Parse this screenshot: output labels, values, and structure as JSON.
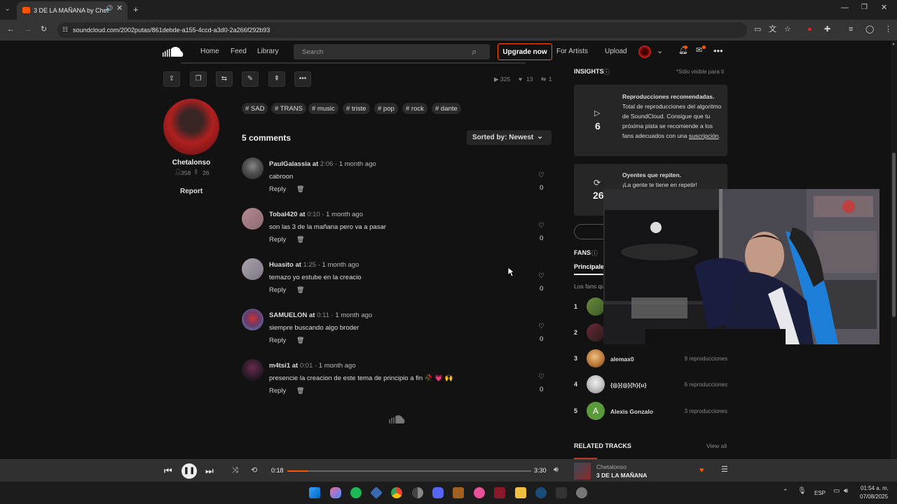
{
  "browser": {
    "tab_title": "3 DE LA MAÑANA by Chet",
    "url": "soundcloud.com/2002putas/861debde-a155-4ccd-a3d0-2a266f292b93"
  },
  "nav": {
    "home": "Home",
    "feed": "Feed",
    "library": "Library",
    "search_placeholder": "Search",
    "upgrade": "Upgrade now",
    "for_artists": "For Artists",
    "upload": "Upload"
  },
  "track_stats": {
    "plays": "325",
    "likes": "13",
    "reposts": "1"
  },
  "tags": [
    "# SAD",
    "# TRANS",
    "# music",
    "# triste",
    "# pop",
    "# rock",
    "# dante"
  ],
  "artist": {
    "name": "Chetalonso",
    "followers": "358",
    "tracks": "26",
    "report": "Report"
  },
  "comments_header": {
    "count": "5 comments",
    "sort": "Sorted by: Newest"
  },
  "comments": [
    {
      "user": "PaulGalassia",
      "at": "at",
      "time": "2:06",
      "ago": "· 1 month ago",
      "text": "cabroon",
      "reply": "Reply",
      "likes": "0"
    },
    {
      "user": "Tobal420",
      "at": "at",
      "time": "0:10",
      "ago": "· 1 month ago",
      "text": "son las 3 de la mañana pero va a pasar",
      "reply": "Reply",
      "likes": "0"
    },
    {
      "user": "Huasito",
      "at": "at",
      "time": "1:25",
      "ago": "· 1 month ago",
      "text": "temazo yo estube en la creacio",
      "reply": "Reply",
      "likes": "0"
    },
    {
      "user": "SAMUELON",
      "at": "at",
      "time": "0:11",
      "ago": "· 1 month ago",
      "text": "siempre buscando algo broder",
      "reply": "Reply",
      "likes": "0"
    },
    {
      "user": "m4tsi1",
      "at": "at",
      "time": "0:01",
      "ago": "· 1 month ago",
      "text": "presencie la creacion de este tema de principio a fin 🥀 💗 🙌",
      "reply": "Reply",
      "likes": "0"
    }
  ],
  "insights": {
    "title": "INSIGHTS",
    "note": "*Sólo visible para ti",
    "card1": {
      "value": "6",
      "title": "Reproducciones recomendadas.",
      "body": "Total de reproducciones del algoritmo de SoundCloud. Consigue que tu próxima pista se recomiende a los fans adecuados con una",
      "link": "suscripción",
      "tail": "."
    },
    "card2": {
      "value": "26",
      "title": "Oyentes que repiten.",
      "body": "¡La gente te tiene en repetir!"
    }
  },
  "fans": {
    "title": "FANS",
    "tab": "Principales",
    "desc": "Los fans qu",
    "list": [
      {
        "rank": "1",
        "name": "",
        "plays": ""
      },
      {
        "rank": "2",
        "name": "",
        "plays": ""
      },
      {
        "rank": "3",
        "name": "alemax0",
        "plays": "9 reproducciones"
      },
      {
        "rank": "4",
        "name": "{◎}{◎}{h}{u}",
        "plays": "6 reproducciones"
      },
      {
        "rank": "5",
        "name": "Alexis Gonzalo",
        "plays": "3 reproducciones",
        "initial": "A"
      }
    ]
  },
  "related": {
    "title": "RELATED TRACKS",
    "view_all": "View all"
  },
  "player": {
    "elapsed": "0:18",
    "duration": "3:30",
    "progress": 0.086,
    "artist": "Chetalonso",
    "title": "3 DE LA MAÑANA"
  },
  "taskbar": {
    "lang": "ESP",
    "time": "01:54 a. m.",
    "date": "07/08/2025"
  }
}
